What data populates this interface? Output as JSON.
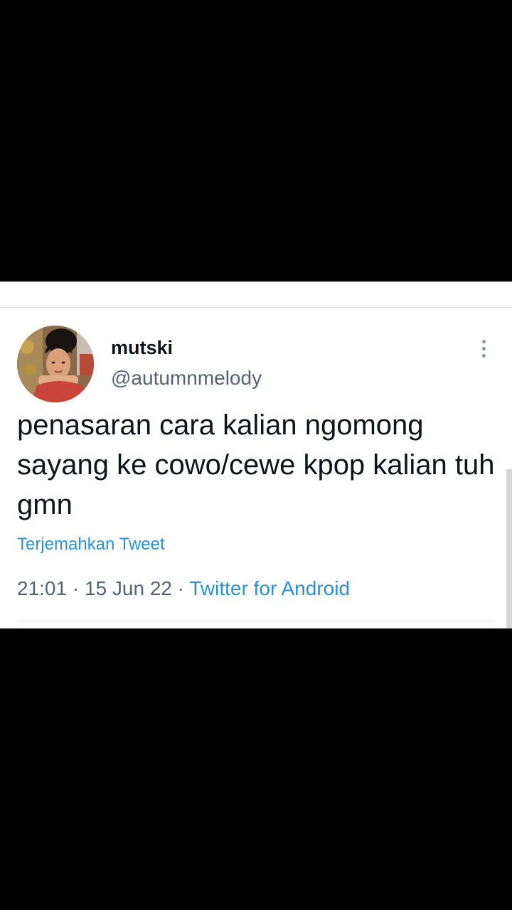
{
  "tweet": {
    "display_name": "mutski",
    "handle": "@autumnmelody",
    "text": "penasaran cara kalian ngomong sayang ke cowo/cewe kpop kalian tuh gmn",
    "translate_label": "Terjemahkan Tweet",
    "time": "21:01",
    "date": "15 Jun 22",
    "separator": "·",
    "source": "Twitter for Android"
  },
  "colors": {
    "link": "#2b8fd3",
    "text": "#0f1419",
    "secondary": "#536471"
  },
  "icons": {
    "more": "more-vertical-icon"
  }
}
